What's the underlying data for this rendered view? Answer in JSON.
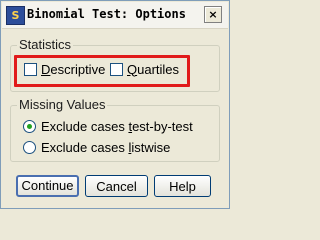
{
  "window": {
    "title": "Binomial Test: Options",
    "close_label": "×",
    "app_icon": "spss-icon"
  },
  "statistics": {
    "label": "Statistics",
    "descriptive": {
      "pre": "",
      "accel": "D",
      "post": "escriptive",
      "checked": false
    },
    "quartiles": {
      "pre": "",
      "accel": "Q",
      "post": "uartiles",
      "checked": false
    }
  },
  "missing_values": {
    "label": "Missing Values",
    "test_by_test": {
      "pre": "Exclude cases ",
      "accel": "t",
      "post": "est-by-test",
      "selected": true
    },
    "listwise": {
      "pre": "Exclude cases ",
      "accel": "l",
      "post": "istwise",
      "selected": false
    }
  },
  "buttons": {
    "continue": "Continue",
    "cancel": "Cancel",
    "help": "Help"
  },
  "colors": {
    "highlight": "#E11B1B",
    "radio_selected": "#21A121",
    "default_button_border": "#4A6FB0"
  }
}
